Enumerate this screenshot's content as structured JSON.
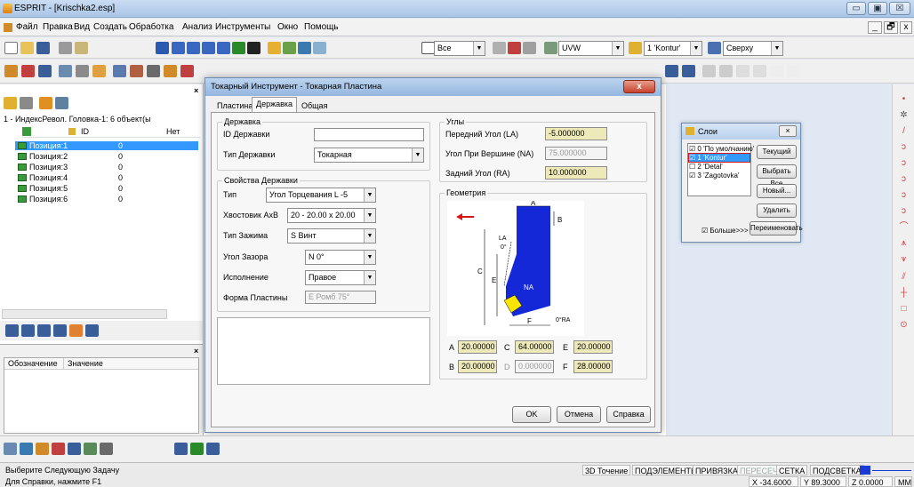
{
  "window": {
    "title": "ESPRIT - [Krischka2.esp]",
    "minimize": "▭",
    "maximize": "▣",
    "close": "☒"
  },
  "menu": {
    "items": [
      "Файл",
      "Правка",
      "Вид",
      "Создать",
      "Обработка",
      "Анализ",
      "Инструменты",
      "Окно",
      "Помощь"
    ],
    "mdi_min": "_",
    "mdi_max": "🗗",
    "mdi_close": "x"
  },
  "toolbar": {
    "select_all": "Все",
    "uvw": "UVW",
    "layer": "1 'Kontur'",
    "view": "Сверху"
  },
  "left_panel": {
    "tree_root": "1 - ИндексРевол. Головка-1: 6 объект(ы",
    "col_id": "ID",
    "col_none": "Нет",
    "positions": [
      {
        "label": "Позиция:1",
        "value": "0"
      },
      {
        "label": "Позиция:2",
        "value": "0"
      },
      {
        "label": "Позиция:3",
        "value": "0"
      },
      {
        "label": "Позиция:4",
        "value": "0"
      },
      {
        "label": "Позиция:5",
        "value": "0"
      },
      {
        "label": "Позиция:6",
        "value": "0"
      }
    ],
    "prop_col_name": "Обозначение",
    "prop_col_value": "Значение"
  },
  "dialog": {
    "title": "Токарный Инструмент - Токарная Пластина",
    "tabs": [
      "Пластина",
      "Державка",
      "Общая"
    ],
    "holder_group": "Державка",
    "holder_id_label": "ID Державки",
    "holder_type_label": "Тип Державки",
    "holder_type_value": "Токарная",
    "props_group": "Свойства Державки",
    "type_label": "Тип",
    "type_value": "Угол Торцевания L -5",
    "shank_label": "Хвостовик AxB",
    "shank_value": "20 - 20.00 x 20.00",
    "clamp_label": "Тип Зажима",
    "clamp_value": "S Винт",
    "clearance_label": "Угол Зазора",
    "clearance_value": "N  0°",
    "exec_label": "Исполнение",
    "exec_value": "Правое",
    "insert_shape_label": "Форма Пластины",
    "insert_shape_value": "E Ромб 75°",
    "angles_group": "Углы",
    "front_angle_label": "Передний Угол (LA)",
    "front_angle_value": "-5.000000",
    "tip_angle_label": "Угол При Вершине (NA)",
    "tip_angle_value": "75.000000",
    "back_angle_label": "Задний Угол (RA)",
    "back_angle_value": "10.000000",
    "geometry_group": "Геометрия",
    "fig": {
      "A": "A",
      "B": "B",
      "C": "C",
      "E": "E",
      "F": "F",
      "LA": "LA",
      "zero": "0°",
      "NA": "NA",
      "RA": "0°RA"
    },
    "dims": {
      "A_label": "A",
      "A": "20.00000",
      "C_label": "C",
      "C": "64.00000",
      "E_label": "E",
      "E": "20.00000",
      "B_label": "B",
      "B": "20.00000",
      "D_label": "D",
      "D": "0.000000",
      "F_label": "F",
      "F": "28.00000"
    },
    "ok": "OK",
    "cancel": "Отмена",
    "help": "Справка"
  },
  "layers": {
    "title": "Слои",
    "items": [
      "0 'По умолчанию'",
      "1 'Kontur'",
      "2 'Detal'",
      "3 'Zagotovka'"
    ],
    "current": "Текущий",
    "select_all": "Выбрать Все",
    "new": "Новый...",
    "delete": "Удалить",
    "rename": "Переименовать",
    "more": "Больше>>>"
  },
  "status": {
    "line1": "Выберите Следующую Задачу",
    "line2": "Для Справки, нажмите F1",
    "modes": [
      "3D Точение",
      "ПОДЭЛЕМЕНТЫ",
      "ПРИВЯЗКА",
      "ПЕРЕСЕЧ",
      "СЕТКА",
      "ПОДСВЕТКА"
    ],
    "x": "X -34.6000",
    "y": "Y 89.3000",
    "z": "Z 0.0000",
    "units": "MM"
  }
}
